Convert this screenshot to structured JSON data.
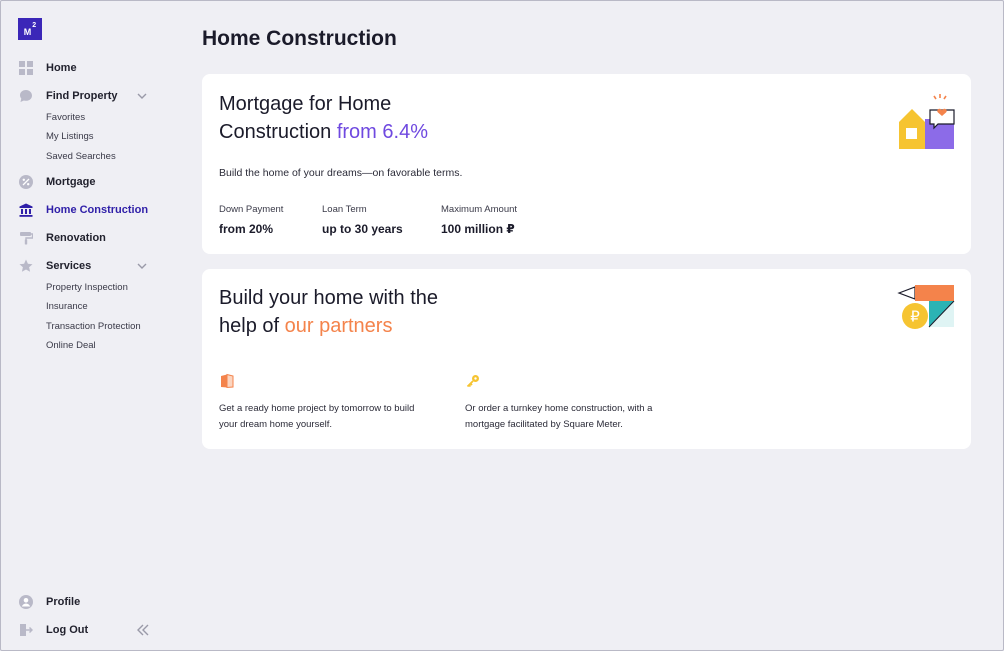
{
  "app": {
    "logo_text": "M",
    "logo_sup": "2"
  },
  "sidebar": {
    "items": [
      {
        "label": "Home",
        "icon": "grid-icon"
      },
      {
        "label": "Find Property",
        "icon": "chat-icon"
      },
      {
        "label": "Mortgage",
        "icon": "percent-icon"
      },
      {
        "label": "Home Construction",
        "icon": "bank-icon"
      },
      {
        "label": "Renovation",
        "icon": "paint-roller-icon"
      },
      {
        "label": "Services",
        "icon": "star-icon"
      }
    ],
    "find_property_sub": [
      "Favorites",
      "My Listings",
      "Saved Searches"
    ],
    "services_sub": [
      "Property Inspection",
      "Insurance",
      "Transaction Protection",
      "Online Deal"
    ],
    "profile_label": "Profile",
    "logout_label": "Log Out"
  },
  "page": {
    "title": "Home Construction"
  },
  "mortgage_card": {
    "title_line1": "Mortgage for Home",
    "title_line2": "Construction",
    "title_accent": "from 6.4%",
    "description": "Build the home of your dreams—on favorable terms.",
    "stats": [
      {
        "label": "Down Payment",
        "value": "from 20%"
      },
      {
        "label": "Loan Term",
        "value": "up to 30 years"
      },
      {
        "label": "Maximum Amount",
        "value": "100 million ₽"
      }
    ]
  },
  "partners_card": {
    "title_line1": "Build your home with the",
    "title_line2": "help of",
    "title_accent": "our partners",
    "features": [
      {
        "text": "Get a ready home project by tomorrow to build your dream home yourself.",
        "icon": "book-icon"
      },
      {
        "text": "Or order a turnkey home construction, with a mortgage facilitated by Square Meter.",
        "icon": "key-icon"
      }
    ]
  },
  "colors": {
    "active": "#2f1fa8",
    "purple": "#6f49e0",
    "orange": "#f4834b",
    "yellow": "#f6c431",
    "teal": "#2bb3b4"
  }
}
